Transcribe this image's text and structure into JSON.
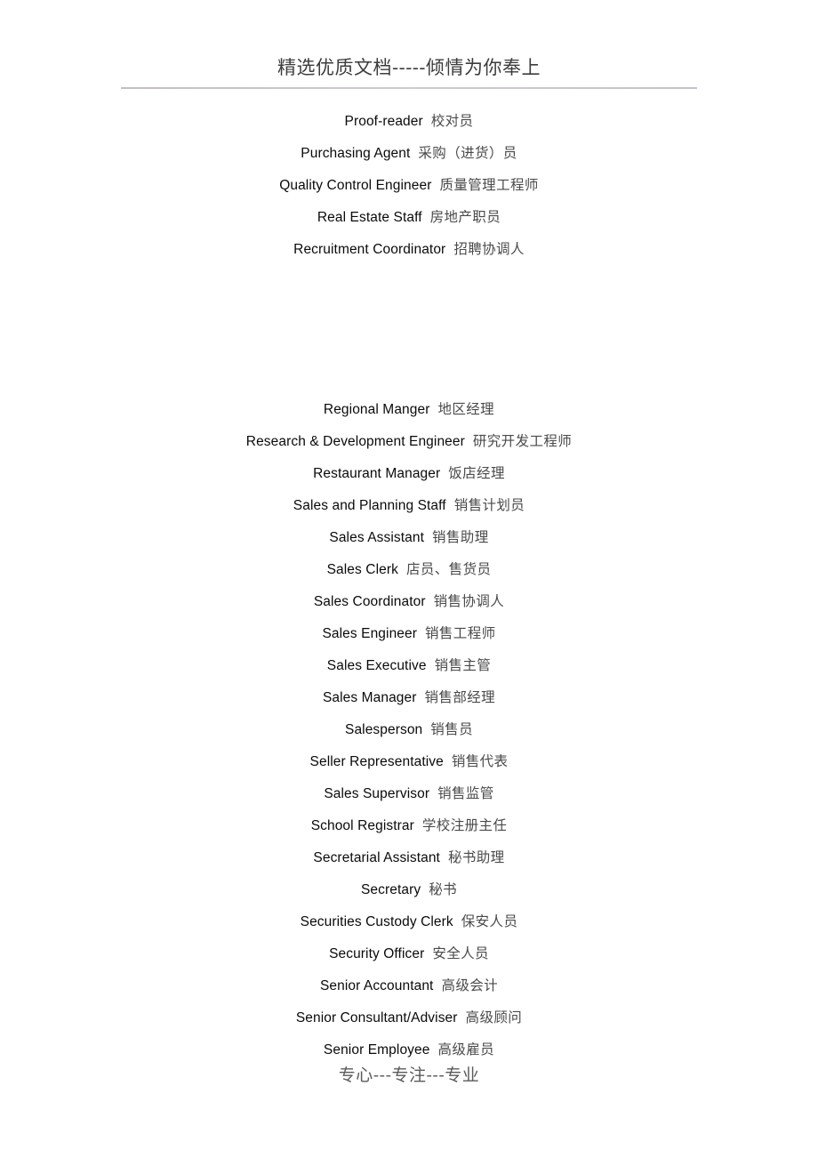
{
  "document": {
    "header_banner": "精选优质文档-----倾情为你奉上",
    "footer_banner": "专心---专注---专业",
    "header_rule_color": "#bdb7c0",
    "english_text_color": "#0a0a0a",
    "chinese_text_color": "#4a4a4a"
  },
  "blocks": [
    {
      "id": "block-1",
      "entries": [
        {
          "en": "Proof-reader",
          "zh": "校对员"
        },
        {
          "en": "Purchasing   Agent",
          "zh": "采购（进货）员"
        },
        {
          "en": "Quality   Control   Engineer",
          "zh": "质量管理工程师"
        },
        {
          "en": "Real   Estate   Staff",
          "zh": "房地产职员"
        },
        {
          "en": "Recruitment   Coordinator",
          "zh": "招聘协调人"
        }
      ]
    },
    {
      "id": "block-2",
      "entries": [
        {
          "en": "Regional   Manger",
          "zh": "地区经理"
        },
        {
          "en": "Research   &   Development   Engineer",
          "zh": "研究开发工程师"
        },
        {
          "en": "Restaurant   Manager",
          "zh": "饭店经理"
        },
        {
          "en": "Sales   and   Planning   Staff",
          "zh": "销售计划员"
        },
        {
          "en": "Sales   Assistant",
          "zh": "销售助理"
        },
        {
          "en": "Sales   Clerk",
          "zh": "店员、售货员"
        },
        {
          "en": "Sales   Coordinator",
          "zh": "销售协调人"
        },
        {
          "en": "Sales   Engineer",
          "zh": "销售工程师"
        },
        {
          "en": "Sales   Executive",
          "zh": "销售主管"
        },
        {
          "en": "Sales   Manager",
          "zh": "销售部经理"
        },
        {
          "en": "Salesperson",
          "zh": "销售员"
        },
        {
          "en": "Seller   Representative",
          "zh": "销售代表"
        },
        {
          "en": "Sales   Supervisor",
          "zh": "销售监管"
        },
        {
          "en": "School   Registrar",
          "zh": "学校注册主任"
        },
        {
          "en": "Secretarial   Assistant",
          "zh": "秘书助理"
        },
        {
          "en": "Secretary",
          "zh": "秘书"
        },
        {
          "en": "Securities   Custody   Clerk",
          "zh": "保安人员"
        },
        {
          "en": "Security   Officer",
          "zh": "安全人员"
        },
        {
          "en": "Senior   Accountant",
          "zh": "高级会计"
        },
        {
          "en": "Senior   Consultant/Adviser",
          "zh": "高级顾问"
        },
        {
          "en": "Senior   Employee",
          "zh": "高级雇员"
        }
      ]
    }
  ],
  "blank_lines_between_blocks": 4
}
